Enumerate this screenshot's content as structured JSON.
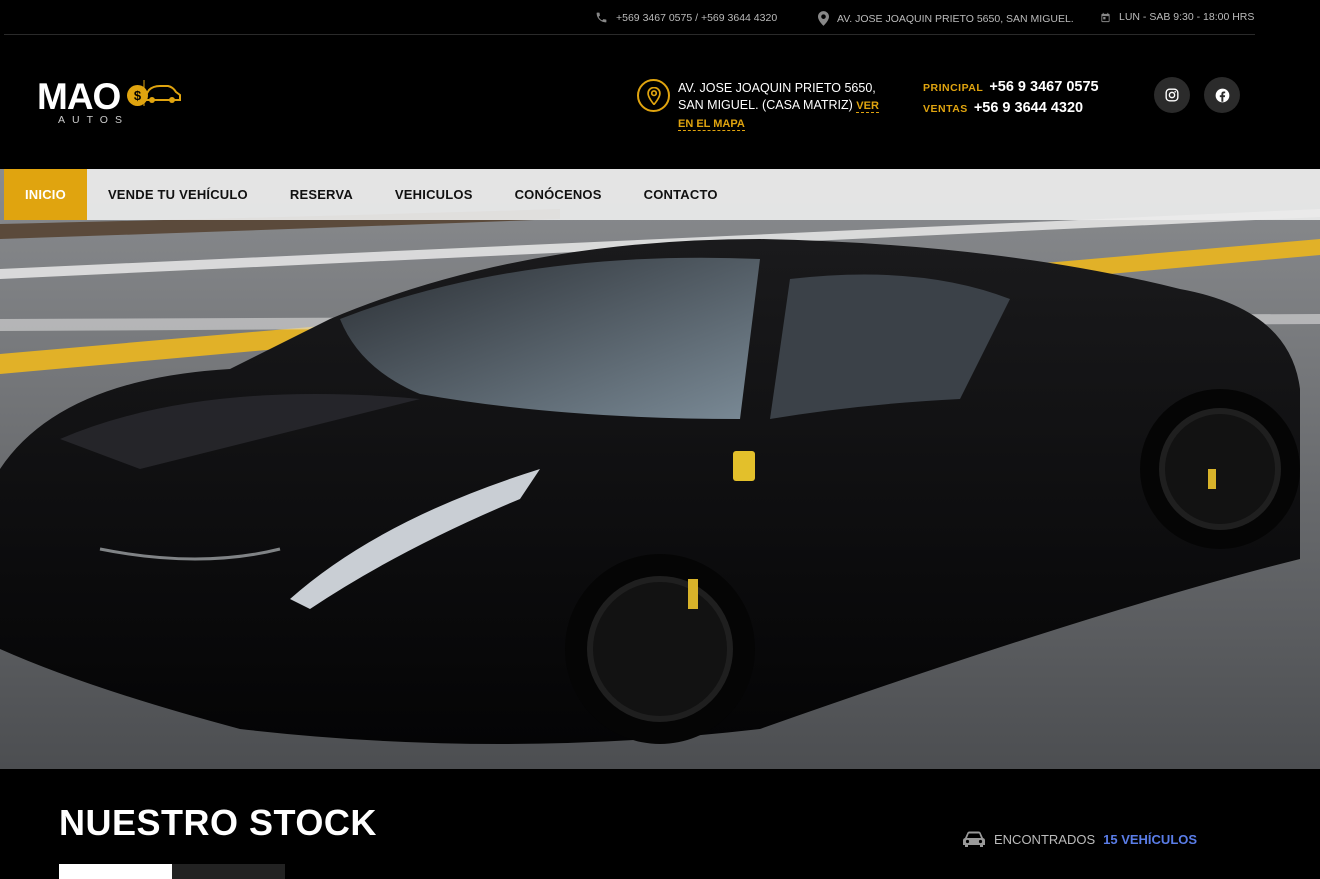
{
  "topbar": {
    "phones": "+569 3467 0575 / +569 3644 4320",
    "address": "AV. JOSE JOAQUIN PRIETO 5650, SAN MIGUEL.",
    "hours": "LUN - SAB 9:30 - 18:00 HRS"
  },
  "brand": {
    "name": "MAO",
    "coin": "$",
    "sub": "AUTOS"
  },
  "header": {
    "address": "AV. JOSE JOAQUIN PRIETO 5650, SAN MIGUEL. (CASA MATRIZ)",
    "map_link": "VER EN EL MAPA",
    "phone_principal_label": "PRINCIPAL",
    "phone_principal": "+56 9 3467 0575",
    "phone_ventas_label": "VENTAS",
    "phone_ventas": "+56 9 3644 4320"
  },
  "nav": {
    "items": [
      "INICIO",
      "VENDE TU VEHÍCULO",
      "RESERVA",
      "VEHICULOS",
      "CONÓCENOS",
      "CONTACTO"
    ],
    "active": "INICIO"
  },
  "stock": {
    "title": "NUESTRO STOCK",
    "found_label": "ENCONTRADOS",
    "found_count": "15 VEHÍCULOS"
  },
  "colors": {
    "accent": "#e0a40f",
    "background": "#000000",
    "count": "#5a7de8"
  },
  "icons": [
    "phone-icon",
    "map-pin-icon",
    "calendar-icon",
    "location-pin-icon",
    "instagram-icon",
    "facebook-icon",
    "car-icon"
  ]
}
